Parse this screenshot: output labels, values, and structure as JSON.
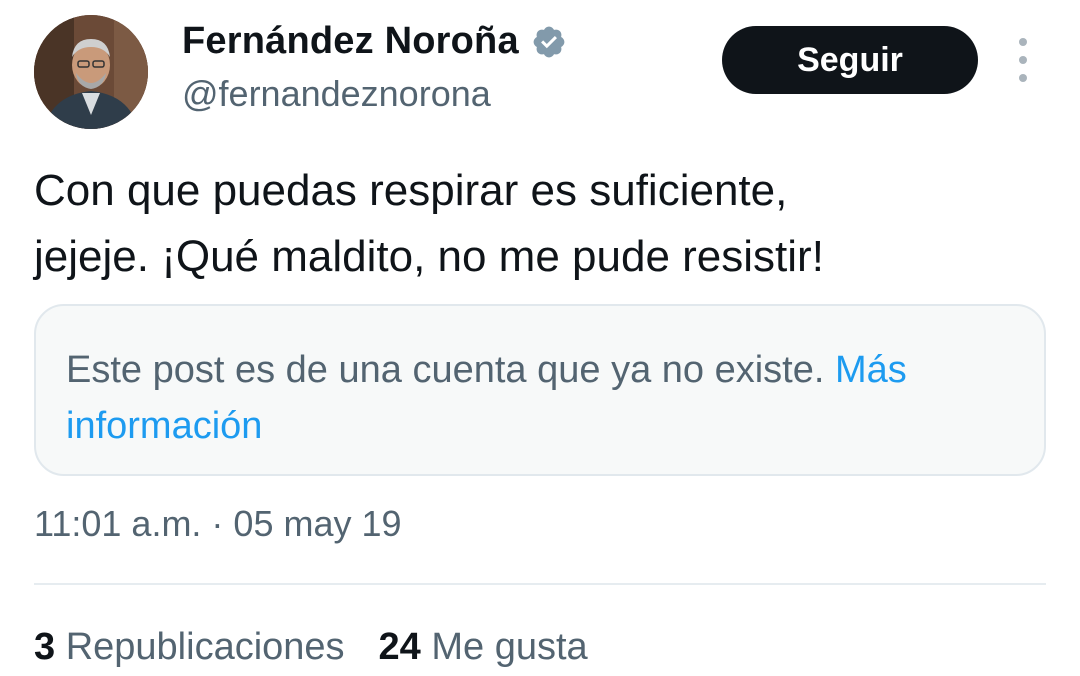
{
  "author": {
    "display_name": "Fernández Noroña",
    "handle": "@fernandeznorona",
    "verified_icon": "verified-badge-icon"
  },
  "actions": {
    "follow_label": "Seguir",
    "more_icon": "more-options-icon"
  },
  "tweet": {
    "text": "Con que puedas respirar es suficiente,\njejeje. ¡Qué maldito, no me pude resistir!",
    "quote_notice": "Este post es de una cuenta que ya no existe.",
    "quote_link": "Más información",
    "timestamp": "11:01 a.m. · 05 may 19"
  },
  "stats": {
    "reposts_count": "3",
    "reposts_label": "Republicaciones",
    "likes_count": "24",
    "likes_label": "Me gusta"
  },
  "colors": {
    "text_primary": "#0f1419",
    "text_secondary": "#536471",
    "link": "#1d9bf0",
    "verified": "#829aab",
    "button_bg": "#0f1419"
  }
}
